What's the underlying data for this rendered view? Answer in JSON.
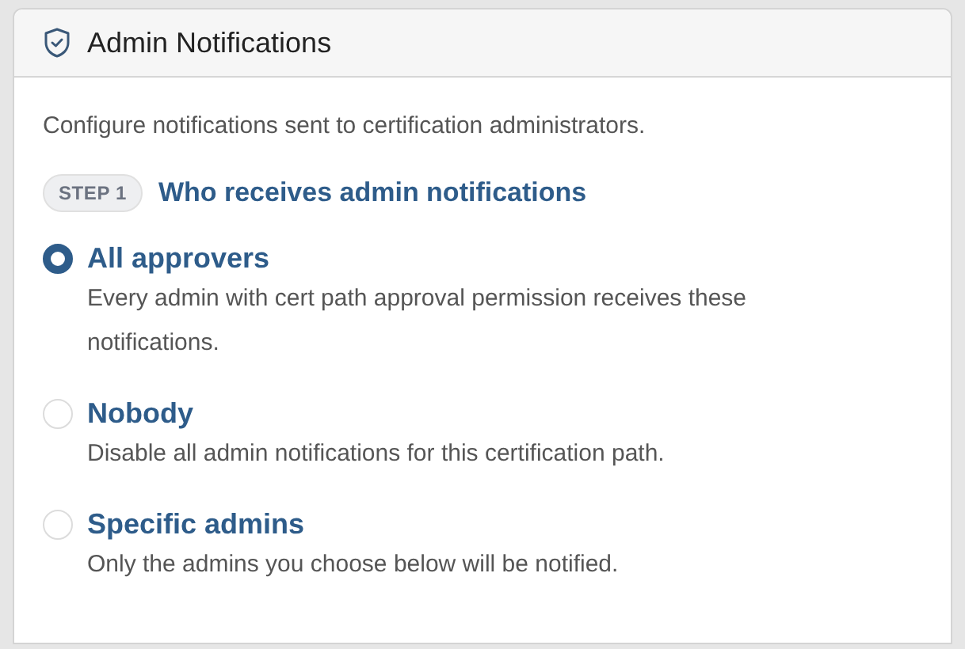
{
  "card": {
    "title": "Admin Notifications"
  },
  "description": "Configure notifications sent to certification administrators.",
  "step": {
    "badge": "STEP 1",
    "heading": "Who receives admin notifications"
  },
  "options": [
    {
      "label": "All approvers",
      "description": "Every admin with cert path approval permission receives these notifications.",
      "selected": true
    },
    {
      "label": "Nobody",
      "description": "Disable all admin notifications for this certification path.",
      "selected": false
    },
    {
      "label": "Specific admins",
      "description": "Only the admins you choose below will be notified.",
      "selected": false
    }
  ]
}
